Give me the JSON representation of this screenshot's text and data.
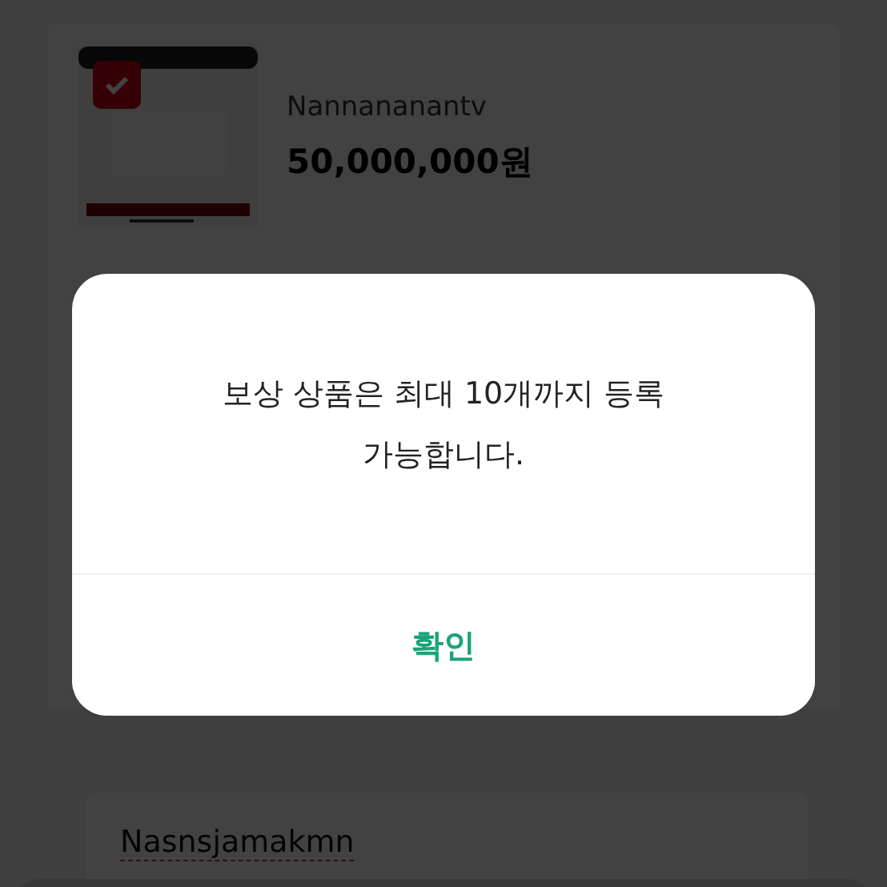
{
  "product_card": {
    "checked": true,
    "name": "Nannananantv",
    "price": "50,000,000원"
  },
  "second_card": {
    "name": "Nasnsjamakmn"
  },
  "dialog": {
    "message": "보상 상품은 최대 10개까지 등록 가능합니다.",
    "confirm_button": "확인"
  }
}
